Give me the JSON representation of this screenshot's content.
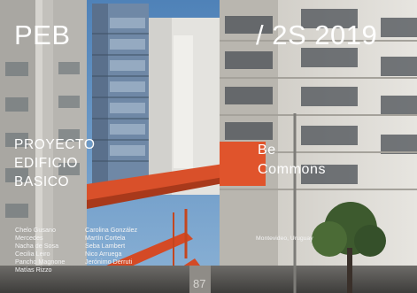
{
  "cover": {
    "journal": "PEB",
    "edition": "/ 2S 2019",
    "project_title": [
      "PROYECTO",
      "EDIFICIO",
      "BASICO"
    ],
    "subtitle": [
      "Be",
      "Commons"
    ],
    "location": "Montevideo, Uruguay",
    "page_number": "87",
    "authors_left": [
      "Chelo Gusano",
      "Mercedes",
      "Nacha de Sosa",
      "Cecilia Leiro",
      "Pancho Magnone",
      "Matías Rizzo"
    ],
    "authors_right": [
      "Carolina González",
      "Martín Cortela",
      "Seba Lambert",
      "Nico Arruega",
      "Jerónimo Derruti"
    ]
  },
  "colors": {
    "sky": "#5e8fbd",
    "accent_orange": "#e0542c",
    "facade_white": "#dcdad4",
    "text": "#ffffff"
  }
}
